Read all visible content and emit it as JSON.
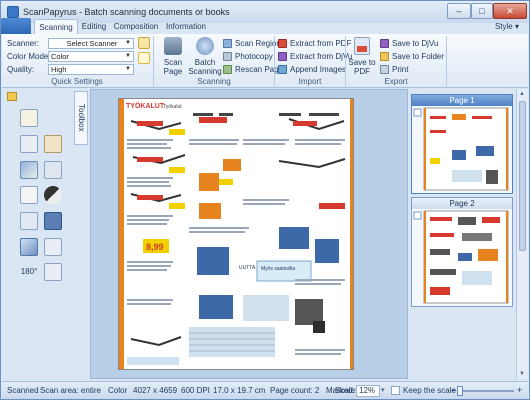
{
  "window": {
    "title": "ScanPapyrus - Batch scanning documents or books"
  },
  "tabs": [
    "Scanning",
    "Editing",
    "Composition",
    "Information"
  ],
  "style_menu": "Style",
  "quick_settings": {
    "scanner_label": "Scanner:",
    "scanner_value": "Select Scanner",
    "color_mode_label": "Color Mode:",
    "color_mode_value": "Color",
    "quality_label": "Quality:",
    "quality_value": "High",
    "group_label": "Quick Settings"
  },
  "scanning_group": {
    "scan_page": "Scan Page",
    "batch_scanning": "Batch Scanning",
    "scan_region": "Scan Region",
    "photocopy": "Photocopy",
    "rescan_page": "Rescan Page",
    "group_label": "Scanning"
  },
  "import_group": {
    "extract_pdf": "Extract from PDF",
    "extract_djvu": "Extract from DjVu",
    "append_images": "Append Images",
    "group_label": "Import"
  },
  "export_group": {
    "save_to_pdf": "Save to PDF",
    "save_to_djvu": "Save to DjVu",
    "save_to_folder": "Save to Folder",
    "print": "Print",
    "group_label": "Export"
  },
  "toolbox_tab": "Toolbox",
  "rotate_label": "180°",
  "page_content": {
    "header": "TYÖKALUT",
    "header_sub": "Työkalut",
    "promo_price": "8,99",
    "promo_note": "Myös saatavilla",
    "tag": "UUTTA"
  },
  "pages": [
    {
      "label": "Page 1",
      "selected": true
    },
    {
      "label": "Page 2",
      "selected": false
    }
  ],
  "status": {
    "state": "Scanned",
    "scan_area": "Scan area: entire",
    "color": "Color",
    "dimensions_px": "4027 x 4659",
    "dpi": "600 DPI",
    "size_cm": "17.0 x 19.7 cm",
    "page_count": "Page count: 2",
    "marked": "Marked: 0",
    "scale_label": "Scale:",
    "scale_value": "12%",
    "keep_scale": "Keep the scale"
  },
  "colors": {
    "accent": "#2e66b3",
    "orange": "#e8841f",
    "yellow_tag": "#f2d100"
  }
}
